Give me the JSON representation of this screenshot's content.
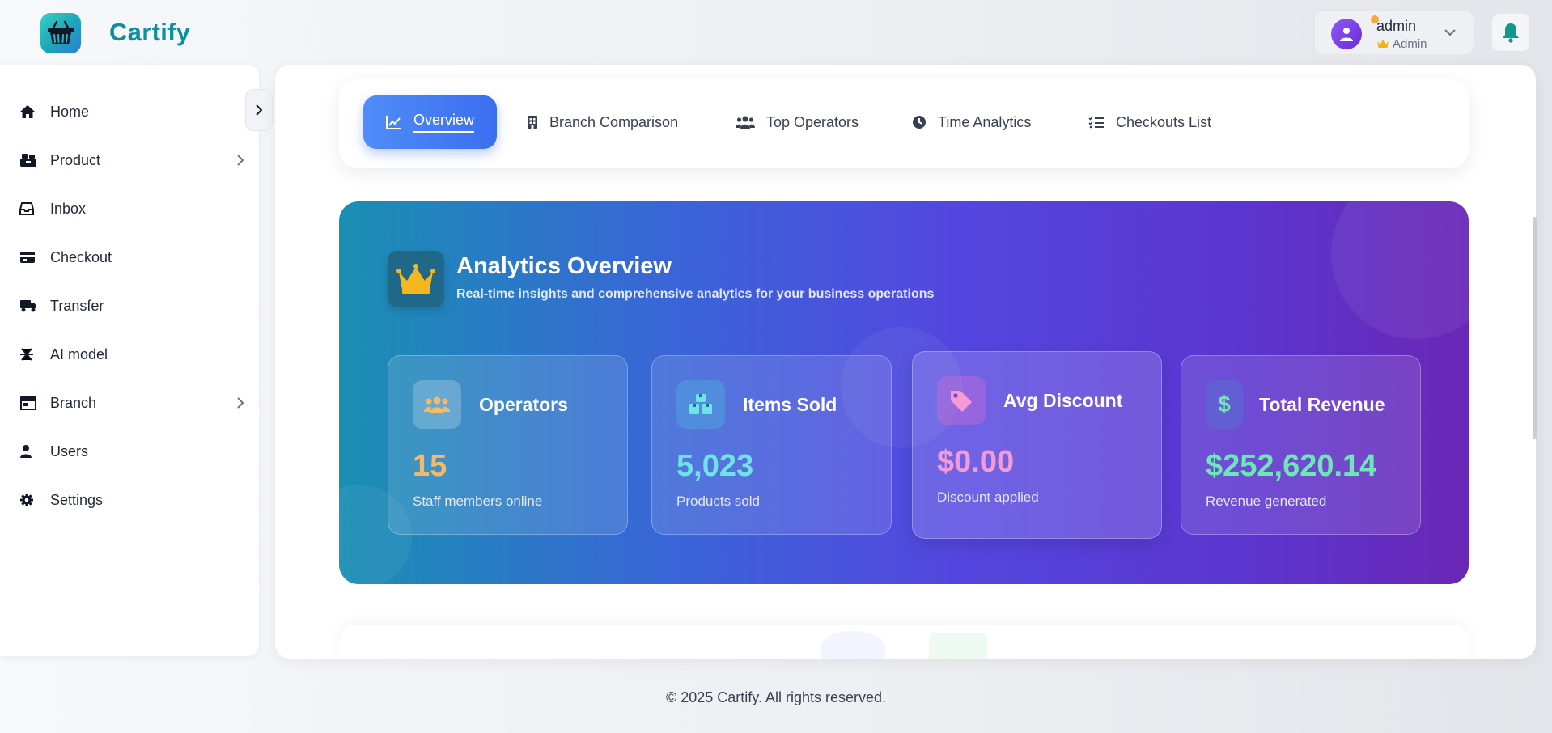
{
  "brand": {
    "name": "Cartify"
  },
  "user": {
    "name": "admin",
    "role": "Admin"
  },
  "sidebar": {
    "items": [
      {
        "label": "Home",
        "icon": "home-icon",
        "has_submenu": false
      },
      {
        "label": "Product",
        "icon": "boxes-icon",
        "has_submenu": true
      },
      {
        "label": "Inbox",
        "icon": "inbox-icon",
        "has_submenu": false
      },
      {
        "label": "Checkout",
        "icon": "credit-card-icon",
        "has_submenu": false
      },
      {
        "label": "Transfer",
        "icon": "truck-icon",
        "has_submenu": false
      },
      {
        "label": "AI model",
        "icon": "network-icon",
        "has_submenu": false
      },
      {
        "label": "Branch",
        "icon": "store-icon",
        "has_submenu": true
      },
      {
        "label": "Users",
        "icon": "user-icon",
        "has_submenu": false
      },
      {
        "label": "Settings",
        "icon": "gear-icon",
        "has_submenu": false
      }
    ]
  },
  "tabs": [
    {
      "label": "Overview",
      "icon": "line-chart-icon",
      "active": true
    },
    {
      "label": "Branch Comparison",
      "icon": "building-icon",
      "active": false
    },
    {
      "label": "Top Operators",
      "icon": "users-icon",
      "active": false
    },
    {
      "label": "Time Analytics",
      "icon": "clock-icon",
      "active": false
    },
    {
      "label": "Checkouts List",
      "icon": "list-check-icon",
      "active": false
    }
  ],
  "hero": {
    "title": "Analytics Overview",
    "subtitle": "Real-time insights and comprehensive analytics for your business operations"
  },
  "stats": [
    {
      "label": "Operators",
      "value": "15",
      "description": "Staff members online",
      "icon": "users-icon",
      "value_color": "#f6b968"
    },
    {
      "label": "Items Sold",
      "value": "5,023",
      "description": "Products sold",
      "icon": "boxes-icon",
      "value_color": "#6fe3e8"
    },
    {
      "label": "Avg Discount",
      "value": "$0.00",
      "description": "Discount applied",
      "icon": "tags-icon",
      "value_color": "#f49ad6"
    },
    {
      "label": "Total Revenue",
      "value": "$252,620.14",
      "description": "Revenue generated",
      "icon": "dollar-icon",
      "value_color": "#6ee7b7"
    }
  ],
  "footer": {
    "text": "© 2025 Cartify. All rights reserved."
  },
  "colors": {
    "accent": "#3b6ef0",
    "brand": "#0f8f9e",
    "bell": "#0f9a8a"
  }
}
